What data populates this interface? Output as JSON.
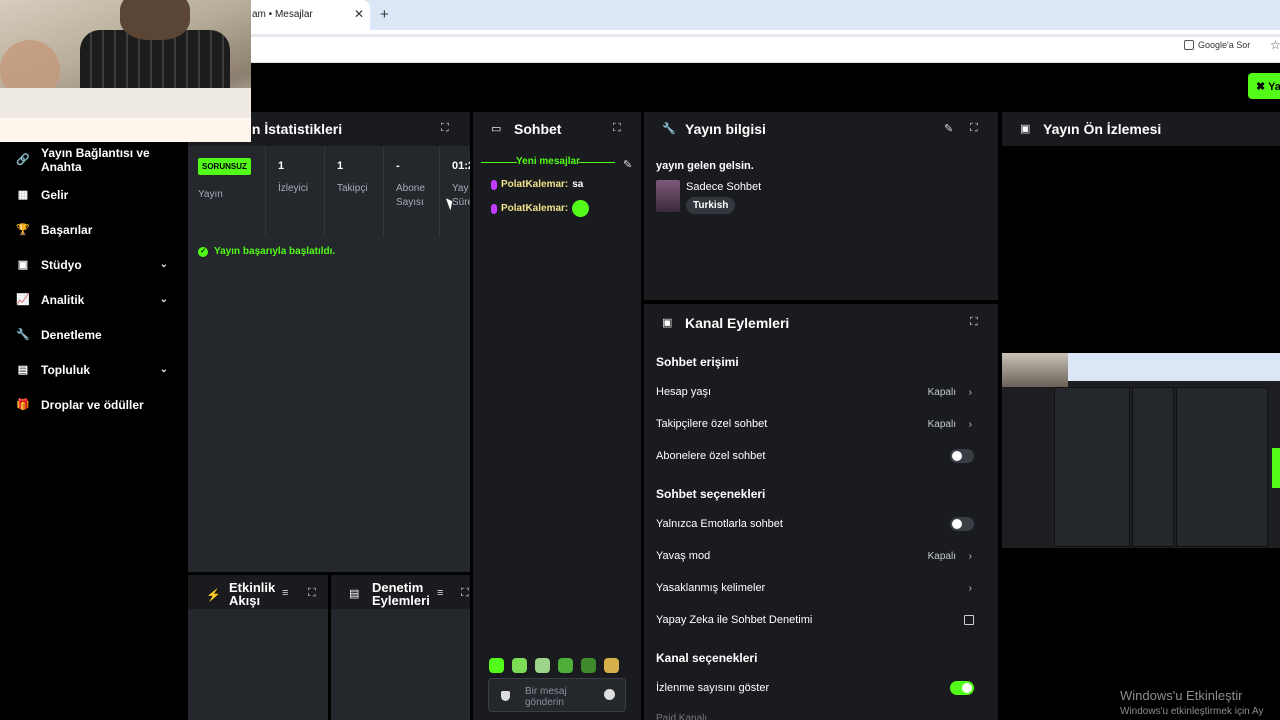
{
  "browser": {
    "tab_title": "am • Mesajlar",
    "tab_close": "✕",
    "tab_new": "+",
    "google_button": "Google'a Sor"
  },
  "header": {
    "live_button": "Yay"
  },
  "sidebar": {
    "items": [
      {
        "label": "Yayın Bağlantısı ve Anahta",
        "icon": "link-icon"
      },
      {
        "label": "Gelir",
        "icon": "revenue-icon"
      },
      {
        "label": "Başarılar",
        "icon": "trophy-icon"
      },
      {
        "label": "Stüdyo",
        "icon": "studio-icon",
        "expandable": true
      },
      {
        "label": "Analitik",
        "icon": "analytics-icon",
        "expandable": true
      },
      {
        "label": "Denetleme",
        "icon": "wrench-icon"
      },
      {
        "label": "Topluluk",
        "icon": "community-icon",
        "expandable": true
      },
      {
        "label": "Droplar ve ödüller",
        "icon": "gift-icon"
      }
    ]
  },
  "stats": {
    "title": "ın İstatistikleri",
    "badge": "SORUNSUZ",
    "stream_label": "Yayın",
    "viewers_value": "1",
    "viewers_label": "İzleyici",
    "followers_value": "1",
    "followers_label": "Takipçi",
    "subs_value": "-",
    "subs_label_1": "Abone",
    "subs_label_2": "Sayısı",
    "duration_value": "01:2",
    "duration_label_1": "Yay",
    "duration_label_2": "Süre",
    "success_message": "Yayın başarıyla başlatıldı."
  },
  "activity": {
    "title_1": "Etkinlik",
    "title_2": "Akışı"
  },
  "moderation": {
    "title_1": "Denetim",
    "title_2": "Eylemleri"
  },
  "chat": {
    "title": "Sohbet",
    "new_messages": "Yeni mesajlar",
    "messages": [
      {
        "user": "PolatKalemar:",
        "text": "sa"
      },
      {
        "user": "PolatKalemar:",
        "text": ""
      }
    ],
    "input_placeholder": "Bir mesaj gönderin"
  },
  "stream_info": {
    "title": "Yayın bilgisi",
    "stream_title": "yayın gelen gelsin.",
    "category": "Sadece Sohbet",
    "language": "Turkish"
  },
  "channel_actions": {
    "title": "Kanal Eylemleri",
    "chat_access_title": "Sohbet erişimi",
    "account_age": {
      "label": "Hesap yaşı",
      "value": "Kapalı"
    },
    "followers_only": {
      "label": "Takipçilere özel sohbet",
      "value": "Kapalı"
    },
    "subscribers_only": {
      "label": "Abonelere özel sohbet",
      "enabled": false
    },
    "chat_options_title": "Sohbet seçenekleri",
    "emotes_only": {
      "label": "Yalnızca Emotlarla sohbet",
      "enabled": false
    },
    "slow_mode": {
      "label": "Yavaş mod",
      "value": "Kapalı"
    },
    "banned_words": {
      "label": "Yasaklanmış kelimeler"
    },
    "ai_moderation": {
      "label": "Yapay Zeka ile Sohbet Denetimi"
    },
    "channel_options_title": "Kanal seçenekleri",
    "show_viewer_count": {
      "label": "İzlenme sayısını göster",
      "enabled": true
    },
    "paid_channel": "Paid Kanalı"
  },
  "preview": {
    "title": "Yayın Ön İzlemesi"
  },
  "windows": {
    "activate_title": "Windows'u Etkinleştir",
    "activate_sub": "Windows'u etkinleştirmek için Ay"
  },
  "colors": {
    "accent": "#53fc18",
    "panel_bg": "#191b1f",
    "body_bg": "#000000"
  }
}
